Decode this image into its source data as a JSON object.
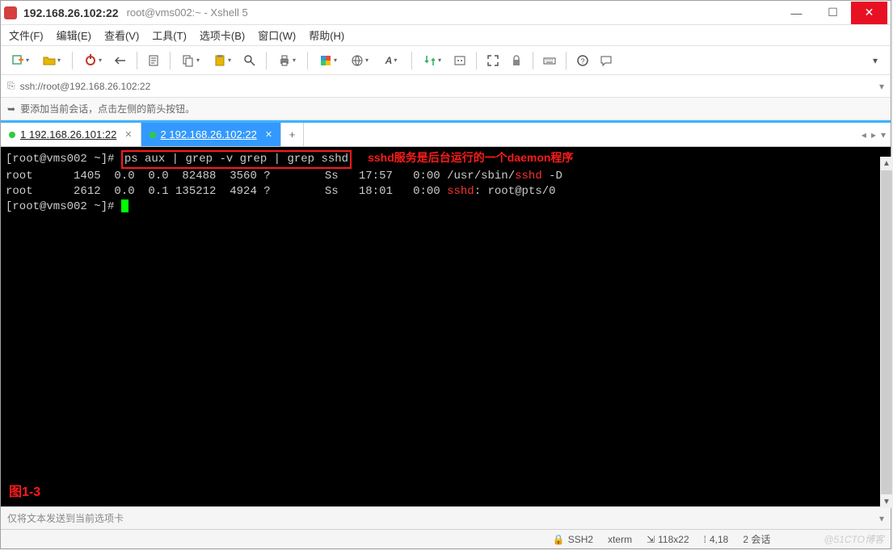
{
  "window": {
    "title_main": "192.168.26.102:22",
    "title_sub": "root@vms002:~ - Xshell 5"
  },
  "menu": {
    "file": "文件(F)",
    "edit": "编辑(E)",
    "view": "查看(V)",
    "tools": "工具(T)",
    "tabs": "选项卡(B)",
    "window": "窗口(W)",
    "help": "帮助(H)"
  },
  "address": {
    "url": "ssh://root@192.168.26.102:22"
  },
  "hint": {
    "text": "要添加当前会话，点击左侧的箭头按钮。"
  },
  "tabs": {
    "items": [
      {
        "num": "1",
        "label": "192.168.26.101:22"
      },
      {
        "num": "2",
        "label": "192.168.26.102:22"
      }
    ]
  },
  "terminal": {
    "prompt1": "[root@vms002 ~]# ",
    "command": "ps aux | grep -v grep | grep sshd",
    "annotation": "sshd服务是后台运行的一个daemon程序",
    "lines": [
      {
        "pre": "root      1405  0.0  0.0  82488  3560 ?        Ss   17:57   0:00 /usr/sbin/",
        "hl": "sshd",
        "post": " -D"
      },
      {
        "pre": "root      2612  0.0  0.1 135212  4924 ?        Ss   18:01   0:00 ",
        "hl": "sshd",
        "post": ": root@pts/0"
      }
    ],
    "prompt2": "[root@vms002 ~]# ",
    "figure": "图1-3"
  },
  "sendbar": {
    "placeholder": "仅将文本发送到当前选项卡"
  },
  "status": {
    "proto": "SSH2",
    "term": "xterm",
    "size": "118x22",
    "pos": "4,18",
    "sessions": "2 会话",
    "watermark": "@51CTO博客"
  }
}
